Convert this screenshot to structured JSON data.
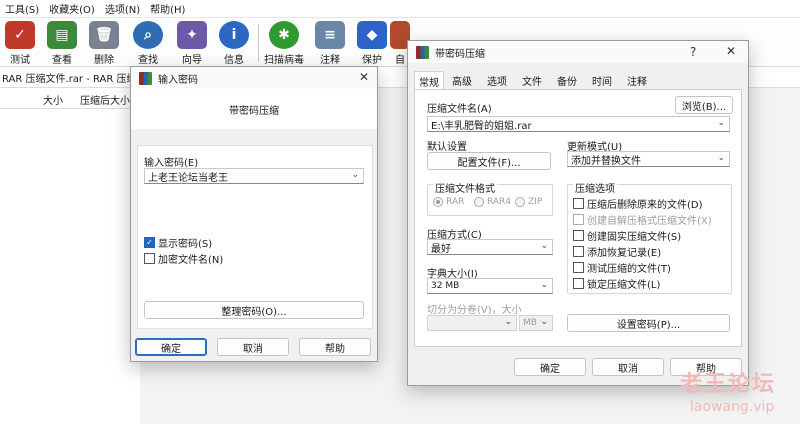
{
  "menu": [
    "工具(S)",
    "收藏夹(O)",
    "选项(N)",
    "帮助(H)"
  ],
  "toolbar": {
    "buttons": [
      {
        "label": "测试",
        "icon": "test-icon",
        "color": "#c0392b"
      },
      {
        "label": "查看",
        "icon": "view-icon",
        "color": "#3d8a3a"
      },
      {
        "label": "删除",
        "icon": "delete-icon",
        "color": "#7a8190"
      },
      {
        "label": "查找",
        "icon": "find-icon",
        "color": "#2f6db3"
      },
      {
        "label": "向导",
        "icon": "wizard-icon",
        "color": "#6b5aa8"
      },
      {
        "label": "信息",
        "icon": "info-icon",
        "color": "#2b68c4"
      },
      {
        "label": "扫描病毒",
        "icon": "virus-scan-icon",
        "color": "#2f9a2f"
      },
      {
        "label": "注释",
        "icon": "comment-icon",
        "color": "#6a87a8"
      },
      {
        "label": "保护",
        "icon": "protect-icon",
        "color": "#2c63c6"
      },
      {
        "label": "自",
        "icon": "sfx-icon",
        "color": "#b34a2d"
      }
    ]
  },
  "pathbar": {
    "text": "RAR 压缩文件.rar - RAR 压缩"
  },
  "columns": {
    "size": "大小",
    "packed": "压缩后大小"
  },
  "password_dialog": {
    "title": "输入密码",
    "heading": "带密码压缩",
    "password_label": "输入密码(E)",
    "password_value": "上老王论坛当老王",
    "show_password": "显示密码(S)",
    "show_password_checked": true,
    "encrypt_names": "加密文件名(N)",
    "encrypt_names_checked": false,
    "organize_button": "整理密码(O)...",
    "ok": "确定",
    "cancel": "取消",
    "help": "帮助"
  },
  "archive_dialog": {
    "title": "带密码压缩",
    "help_glyph": "?",
    "tabs": [
      "常规",
      "高级",
      "选项",
      "文件",
      "备份",
      "时间",
      "注释"
    ],
    "archive_name_label": "压缩文件名(A)",
    "archive_name_value": "E:\\丰乳肥臀的姐姐.rar",
    "browse": "浏览(B)...",
    "default_settings": "默认设置",
    "profiles": "配置文件(F)...",
    "update_mode_label": "更新模式(U)",
    "update_mode_value": "添加并替换文件",
    "format_group": "压缩文件格式",
    "formats": [
      "RAR",
      "RAR4",
      "ZIP"
    ],
    "method_label": "压缩方式(C)",
    "method_value": "最好",
    "dict_label": "字典大小(I)",
    "dict_value": "32 MB",
    "split_label": "切分为分卷(V)，大小",
    "split_unit": "MB",
    "options_group": "压缩选项",
    "options": [
      {
        "label": "压缩后删除原来的文件(D)",
        "checked": false,
        "disabled": false
      },
      {
        "label": "创建自解压格式压缩文件(X)",
        "checked": false,
        "disabled": true
      },
      {
        "label": "创建固实压缩文件(S)",
        "checked": false,
        "disabled": false
      },
      {
        "label": "添加恢复记录(E)",
        "checked": false,
        "disabled": false
      },
      {
        "label": "测试压缩的文件(T)",
        "checked": false,
        "disabled": false
      },
      {
        "label": "锁定压缩文件(L)",
        "checked": false,
        "disabled": false
      }
    ],
    "set_password": "设置密码(P)...",
    "ok": "确定",
    "cancel": "取消",
    "help": "帮助"
  },
  "watermark": {
    "line1": "老王论坛",
    "line2": "laowang.vip"
  }
}
